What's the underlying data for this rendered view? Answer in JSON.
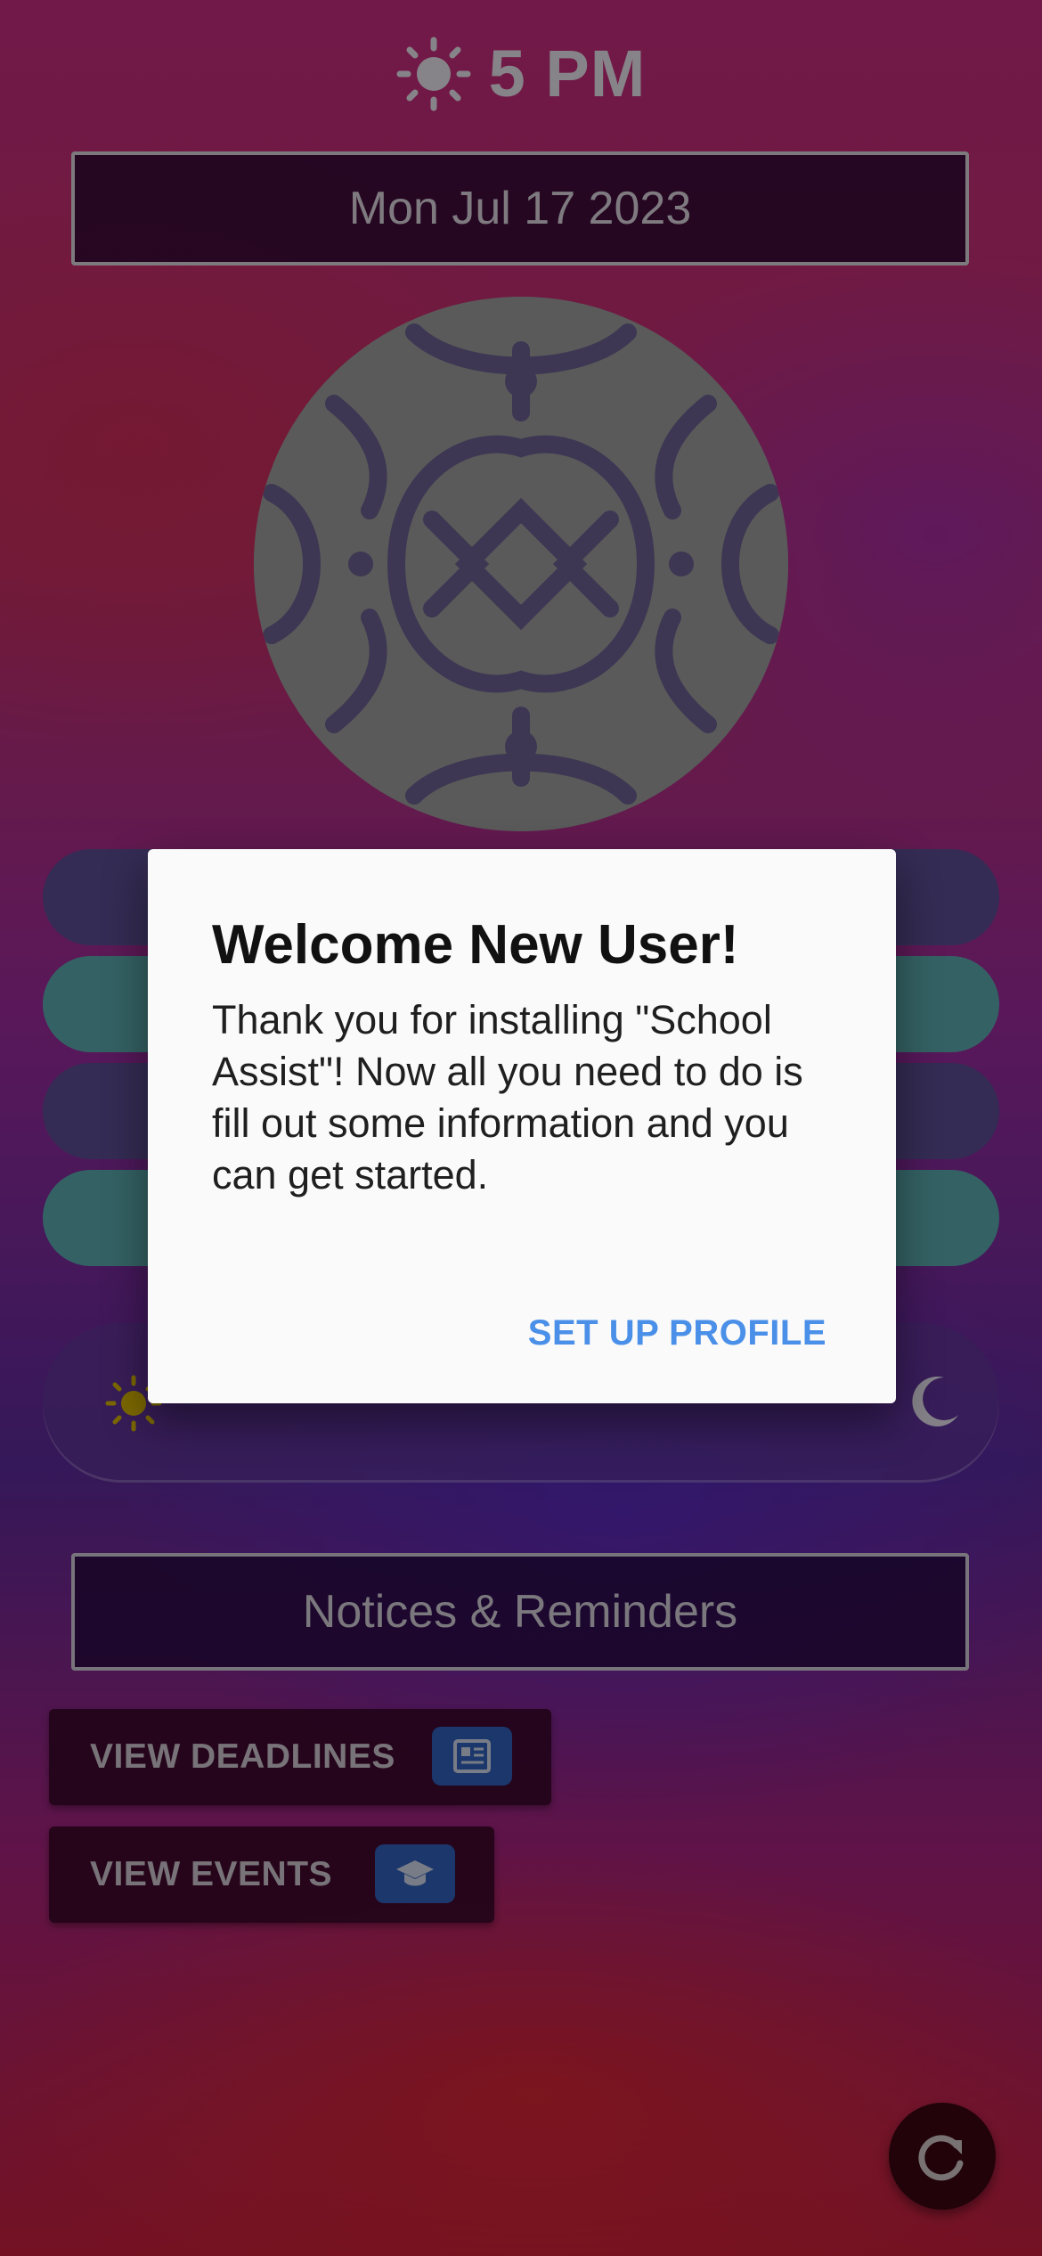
{
  "header": {
    "time": "5 PM",
    "time_icon": "sun-icon"
  },
  "date": "Mon Jul 17 2023",
  "theme_toggle": {
    "left_icon": "sun-icon",
    "right_icon": "moon-icon"
  },
  "notices": {
    "title": "Notices & Reminders",
    "buttons": [
      {
        "label": "VIEW DEADLINES",
        "icon": "newspaper-icon"
      },
      {
        "label": "VIEW EVENTS",
        "icon": "graduation-cap-icon"
      }
    ]
  },
  "refresh_icon": "refresh-icon",
  "colors": {
    "pill_purple": "#5a4c92",
    "pill_teal": "#5aa9ad",
    "badge_blue": "#2f5fb8",
    "dialog_action": "#4a8fe8"
  },
  "dialog": {
    "title": "Welcome New User!",
    "body": "Thank you for installing \"School Assist\"! Now all you need to do is fill out some information and you can get started.",
    "action": "SET UP PROFILE"
  }
}
